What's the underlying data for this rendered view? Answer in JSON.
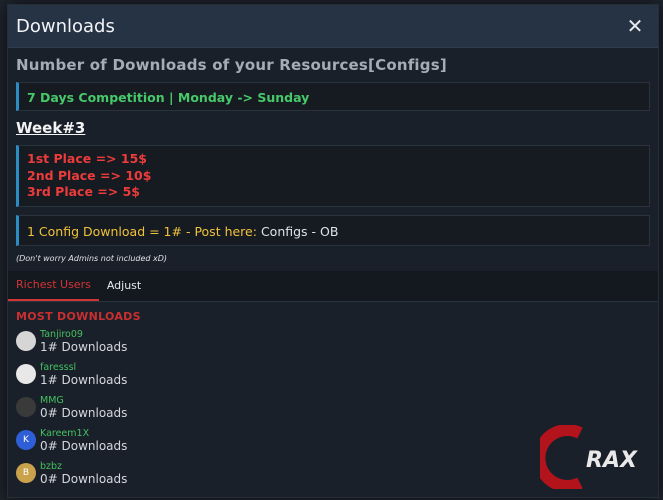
{
  "modal": {
    "title": "Downloads"
  },
  "heading": "Number of Downloads of your Resources[Configs]",
  "competition": "7 Days Competition | Monday -> Sunday",
  "week": "Week#3",
  "prizes": [
    "1st Place => 15$",
    "2nd Place => 10$",
    "3rd Place => 5$"
  ],
  "rule": {
    "text": "1 Config Download = 1# - Post here: ",
    "link": "Configs - OB"
  },
  "note": "(Don't worry Admins not included xD)",
  "tabs": [
    {
      "label": "Richest Users"
    },
    {
      "label": "Adjust"
    }
  ],
  "list": {
    "title": "MOST DOWNLOADS",
    "users": [
      {
        "name": "Tanjiro09",
        "count": "1# Downloads",
        "avatar_color": "#d6d6d6",
        "avatar_initial": ""
      },
      {
        "name": "faresssl",
        "count": "1# Downloads",
        "avatar_color": "#e8e8e8",
        "avatar_initial": ""
      },
      {
        "name": "MMG",
        "count": "0# Downloads",
        "avatar_color": "#3a3a3a",
        "avatar_initial": ""
      },
      {
        "name": "Kareem1X",
        "count": "0# Downloads",
        "avatar_color": "#2f5fd6",
        "avatar_initial": "K"
      },
      {
        "name": "bzbz",
        "count": "0# Downloads",
        "avatar_color": "#caa24b",
        "avatar_initial": "B"
      }
    ]
  },
  "watermark": {
    "text": "RAX"
  },
  "colors": {
    "accent_red": "#d13434",
    "name_green": "#44c05e",
    "box_border_blue": "#2c8dc2",
    "yellow": "#f0c23a"
  }
}
